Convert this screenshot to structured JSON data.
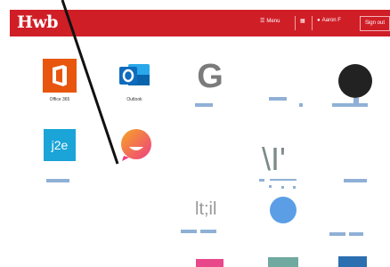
{
  "header": {
    "logo": "Hwb",
    "menu_label": "Menu",
    "user_label": "Aaron F",
    "signout_label": "Sign out"
  },
  "apps": {
    "office365_label": "Office 365",
    "outlook_label": "Outlook",
    "j2e_text": "j2e",
    "g_letter": "G",
    "glyph_mid": "\\I'",
    "glyph_lt": "lt;il"
  },
  "colors": {
    "header": "#d01e27",
    "office": "#e8560d",
    "outlook": "#0f6cbd",
    "j2e": "#1aa4d8",
    "blue_circle": "#5b9ee6",
    "pink": "#e8478a",
    "teal": "#6fa9a0",
    "navy": "#2c6fb0"
  }
}
